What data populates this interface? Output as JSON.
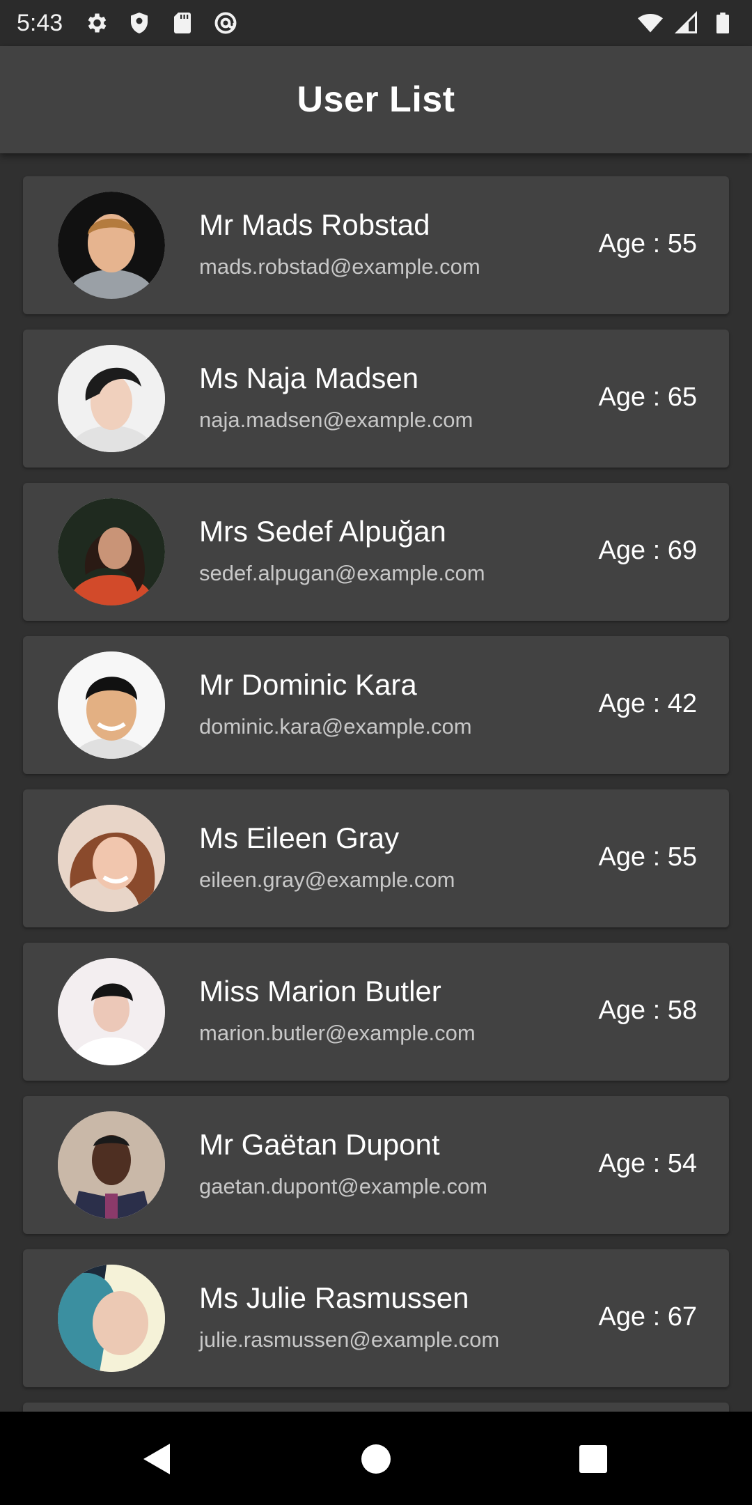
{
  "status_bar": {
    "time": "5:43",
    "left_icons": [
      "gear-icon",
      "shield-icon",
      "sd-card-icon",
      "at-sign-icon"
    ],
    "right_icons": [
      "wifi-icon",
      "signal-icon",
      "battery-icon"
    ]
  },
  "app_bar": {
    "title": "User List"
  },
  "users": [
    {
      "name": "Mr Mads Robstad",
      "email": "mads.robstad@example.com",
      "age": "Age : 55",
      "avatar": "avatar-photo"
    },
    {
      "name": "Ms Naja Madsen",
      "email": "naja.madsen@example.com",
      "age": "Age : 65",
      "avatar": "avatar-photo"
    },
    {
      "name": "Mrs Sedef Alpuğan",
      "email": "sedef.alpugan@example.com",
      "age": "Age : 69",
      "avatar": "avatar-photo"
    },
    {
      "name": "Mr Dominic Kara",
      "email": "dominic.kara@example.com",
      "age": "Age : 42",
      "avatar": "avatar-photo"
    },
    {
      "name": "Ms Eileen Gray",
      "email": "eileen.gray@example.com",
      "age": "Age : 55",
      "avatar": "avatar-photo"
    },
    {
      "name": "Miss Marion Butler",
      "email": "marion.butler@example.com",
      "age": "Age : 58",
      "avatar": "avatar-photo"
    },
    {
      "name": "Mr Gaëtan Dupont",
      "email": "gaetan.dupont@example.com",
      "age": "Age : 54",
      "avatar": "avatar-photo"
    },
    {
      "name": "Ms Julie Rasmussen",
      "email": "julie.rasmussen@example.com",
      "age": "Age : 67",
      "avatar": "avatar-photo"
    }
  ],
  "nav_bar": {
    "buttons": [
      "back-icon",
      "home-icon",
      "recents-icon"
    ]
  }
}
